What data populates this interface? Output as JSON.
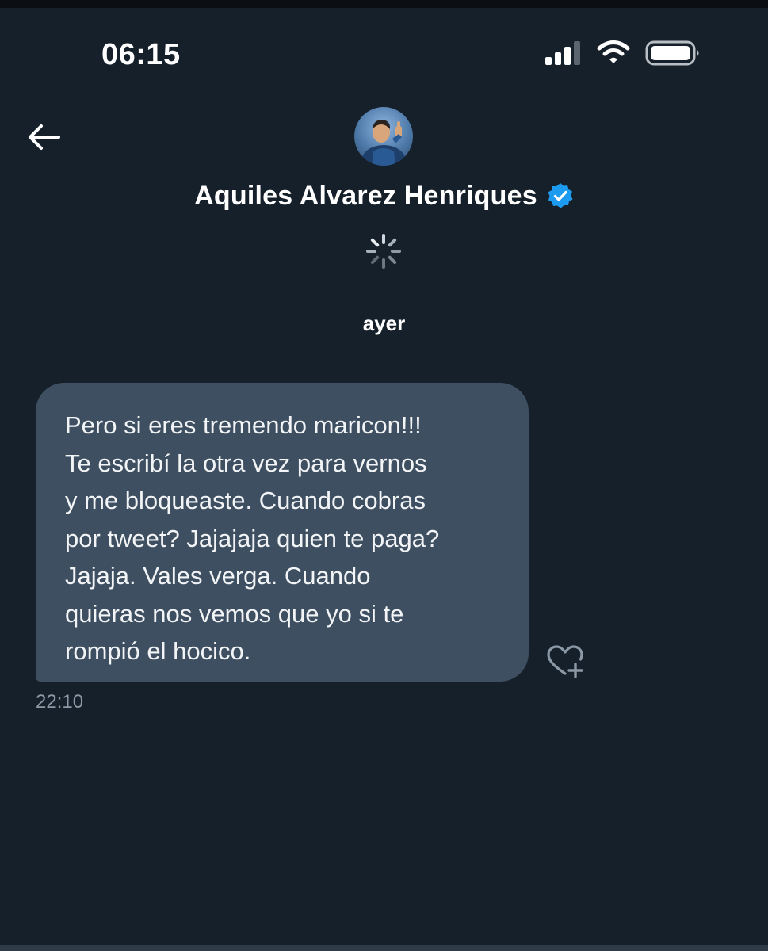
{
  "status_bar": {
    "time": "06:15",
    "icons": [
      "signal-icon",
      "wifi-icon",
      "battery-icon"
    ]
  },
  "header": {
    "back_icon": "back-arrow-icon",
    "contact_name": "Aquiles Alvarez Henriques",
    "verified_icon": "verified-badge-icon",
    "avatar_icon": "avatar",
    "loading_icon": "spinner-icon"
  },
  "conversation": {
    "date_separator": "ayer",
    "messages": [
      {
        "text": "Pero si eres tremendo maricon!!!\nTe escribí la otra vez para vernos\ny me bloqueaste. Cuando cobras\npor tweet? Jajajaja quien te paga?\nJajaja. Vales verga. Cuando\nquieras nos vemos que yo si te\nrompió el hocico.",
        "time": "22:10",
        "reaction_icon": "add-reaction-icon"
      }
    ]
  },
  "colors": {
    "background": "#15202b",
    "bubble": "#3e4f61",
    "verified": "#1d9bf0",
    "muted_text": "#8b98a5"
  }
}
